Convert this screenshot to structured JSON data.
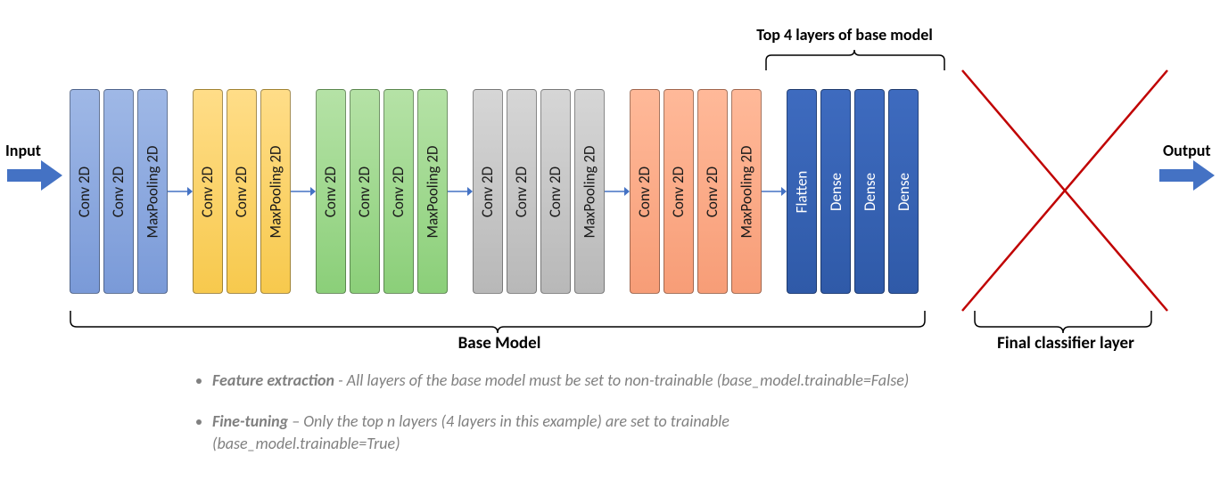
{
  "labels": {
    "input": "Input",
    "output": "Output",
    "top_annotation": "Top 4 layers of base model",
    "base_model": "Base Model",
    "final_classifier": "Final classifier layer"
  },
  "groups": {
    "g1": [
      "Conv 2D",
      "Conv 2D",
      "MaxPooling 2D"
    ],
    "g2": [
      "Conv 2D",
      "Conv 2D",
      "MaxPooling 2D"
    ],
    "g3": [
      "Conv 2D",
      "Conv 2D",
      "Conv 2D",
      "MaxPooling 2D"
    ],
    "g4": [
      "Conv 2D",
      "Conv 2D",
      "Conv 2D",
      "MaxPooling 2D"
    ],
    "g5": [
      "Conv 2D",
      "Conv 2D",
      "Conv 2D",
      "MaxPooling 2D"
    ],
    "g6": [
      "Flatten",
      "Dense",
      "Dense",
      "Dense"
    ]
  },
  "bullets": {
    "b1_lead": "Feature extraction",
    "b1_rest": " - All layers of the base model must be set to non-trainable (base_model.trainable=False)",
    "b2_lead": "Fine-tuning",
    "b2_rest": " – Only the top n layers (4 layers in this example) are set to trainable (base_model.trainable=True)"
  }
}
